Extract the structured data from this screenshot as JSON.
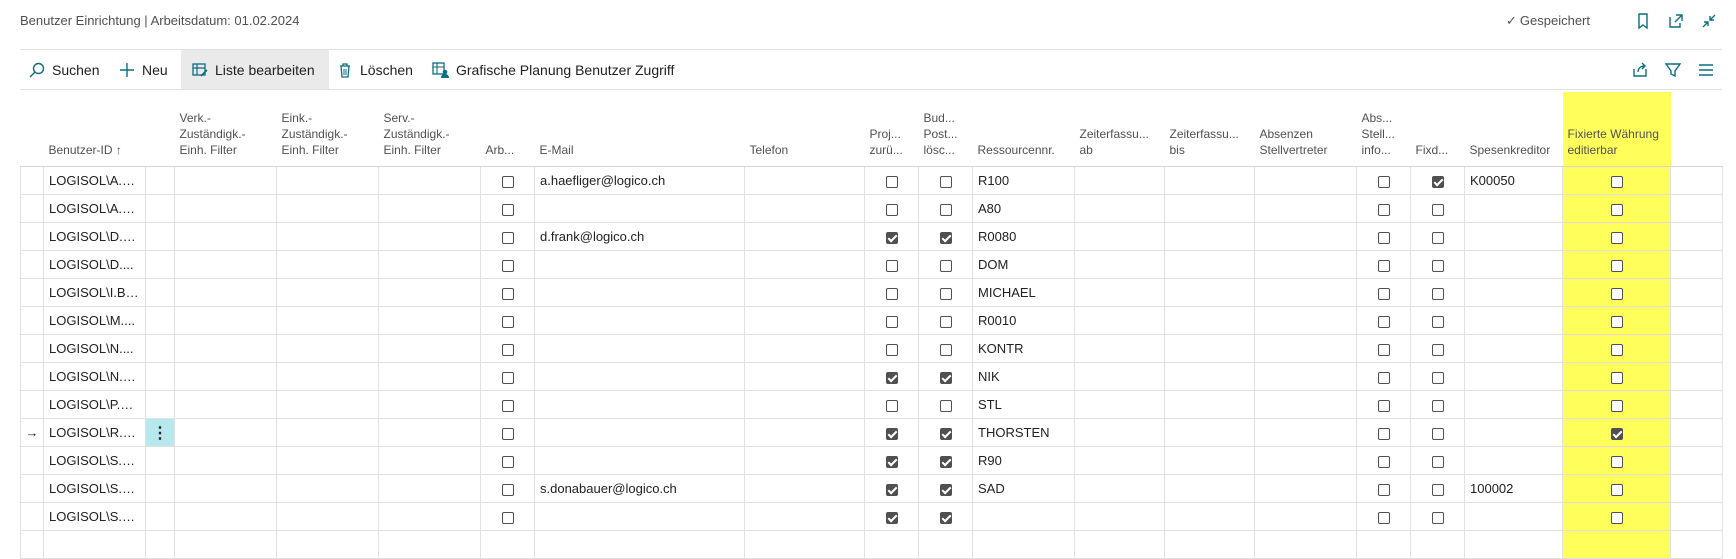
{
  "header": {
    "title": "Benutzer Einrichtung | Arbeitsdatum: 01.02.2024",
    "saved_label": "Gespeichert"
  },
  "toolbar": {
    "search_label": "Suchen",
    "new_label": "Neu",
    "edit_list_label": "Liste bearbeiten",
    "delete_label": "Löschen",
    "planning_label": "Grafische Planung Benutzer Zugriff"
  },
  "columns": [
    "Benutzer-ID",
    "Verk.-Zuständigk.-Einh. Filter",
    "Eink.-Zuständigk.-Einh. Filter",
    "Serv.-Zuständigk.-Einh. Filter",
    "Arb...",
    "E-Mail",
    "Telefon",
    "Proj... zurü...",
    "Bud... Post... lösc...",
    "Ressourcennr.",
    "Zeiterfassu... ab",
    "Zeiterfassu... bis",
    "Absenzen Stellvertreter",
    "Abs... Stell... info...",
    "Fixd...",
    "Spesenkreditor",
    "Fixierte Währung editierbar"
  ],
  "sort_indicator": "↑",
  "rows": [
    {
      "user": "LOGISOL\\A.H...",
      "arb": false,
      "email": "a.haefliger@logico.ch",
      "proj": false,
      "bud": false,
      "res": "R100",
      "abs": false,
      "fix": true,
      "spesen": "K00050",
      "fixw": false
    },
    {
      "user": "LOGISOL\\A.N...",
      "arb": false,
      "email": "",
      "proj": false,
      "bud": false,
      "res": "A80",
      "abs": false,
      "fix": false,
      "spesen": "",
      "fixw": false
    },
    {
      "user": "LOGISOL\\D.F...",
      "arb": false,
      "email": "d.frank@logico.ch",
      "proj": true,
      "bud": true,
      "res": "R0080",
      "abs": false,
      "fix": false,
      "spesen": "",
      "fixw": false
    },
    {
      "user": "LOGISOL\\D....",
      "arb": false,
      "email": "",
      "proj": false,
      "bud": false,
      "res": "DOM",
      "abs": false,
      "fix": false,
      "spesen": "",
      "fixw": false
    },
    {
      "user": "LOGISOL\\I.BL...",
      "arb": false,
      "email": "",
      "proj": false,
      "bud": false,
      "res": "MICHAEL",
      "abs": false,
      "fix": false,
      "spesen": "",
      "fixw": false
    },
    {
      "user": "LOGISOL\\M....",
      "arb": false,
      "email": "",
      "proj": false,
      "bud": false,
      "res": "R0010",
      "abs": false,
      "fix": false,
      "spesen": "",
      "fixw": false
    },
    {
      "user": "LOGISOL\\N....",
      "arb": false,
      "email": "",
      "proj": false,
      "bud": false,
      "res": "KONTR",
      "abs": false,
      "fix": false,
      "spesen": "",
      "fixw": false
    },
    {
      "user": "LOGISOL\\N.K...",
      "arb": false,
      "email": "",
      "proj": true,
      "bud": true,
      "res": "NIK",
      "abs": false,
      "fix": false,
      "spesen": "",
      "fixw": false
    },
    {
      "user": "LOGISOL\\P.D...",
      "arb": false,
      "email": "",
      "proj": false,
      "bud": false,
      "res": "STL",
      "abs": false,
      "fix": false,
      "spesen": "",
      "fixw": false
    },
    {
      "user": "LOGISOL\\R.G...",
      "arb": false,
      "email": "",
      "proj": true,
      "bud": true,
      "res": "THORSTEN",
      "abs": false,
      "fix": false,
      "spesen": "",
      "fixw": true,
      "current": true
    },
    {
      "user": "LOGISOL\\S.B...",
      "arb": false,
      "email": "",
      "proj": true,
      "bud": true,
      "res": "R90",
      "abs": false,
      "fix": false,
      "spesen": "",
      "fixw": false
    },
    {
      "user": "LOGISOL\\S.D...",
      "arb": false,
      "email": "s.donabauer@logico.ch",
      "proj": true,
      "bud": true,
      "res": "SAD",
      "abs": false,
      "fix": false,
      "spesen": "100002",
      "fixw": false
    },
    {
      "user": "LOGISOL\\S.LI...",
      "arb": false,
      "email": "",
      "proj": true,
      "bud": true,
      "res": "",
      "abs": false,
      "fix": false,
      "spesen": "",
      "fixw": false
    }
  ],
  "current_row_marker": "→",
  "row_menu_glyph": "⋮",
  "highlight_color": "#ffff5c"
}
